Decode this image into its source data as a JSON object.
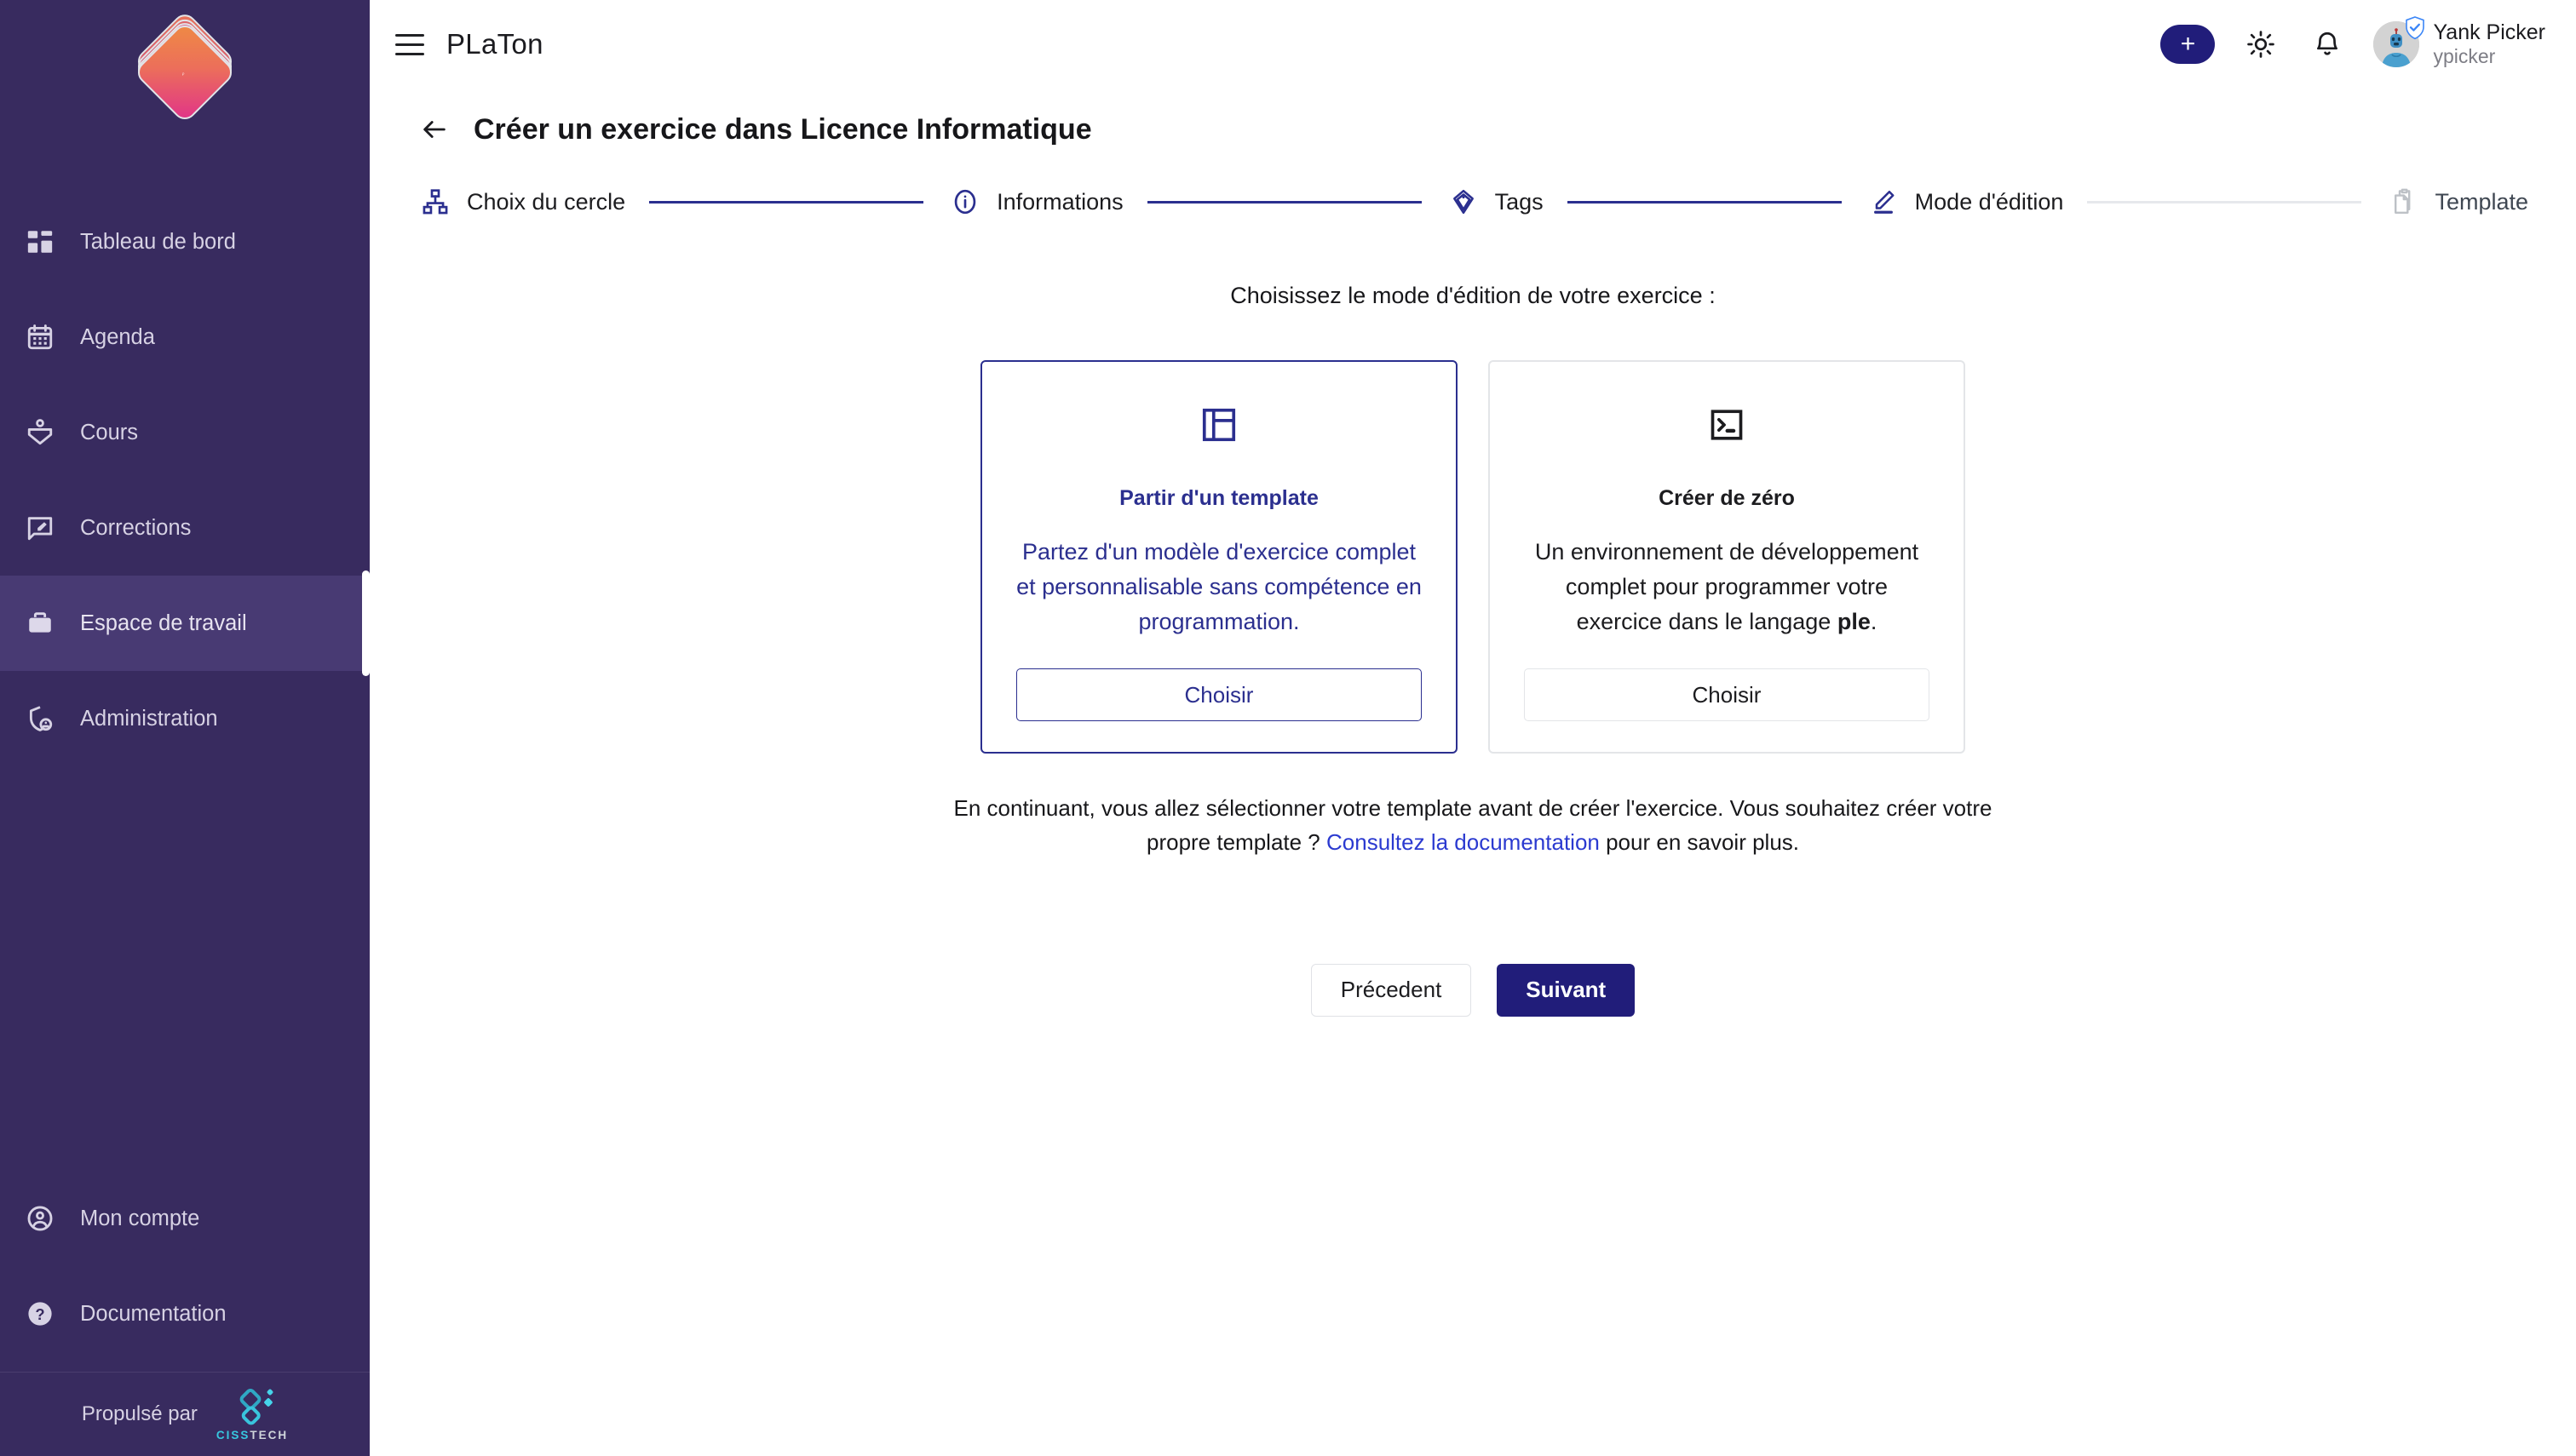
{
  "sidebar": {
    "logo_name": "platon-logo",
    "items": [
      {
        "label": "Tableau de bord",
        "icon": "dashboard-icon",
        "active": false
      },
      {
        "label": "Agenda",
        "icon": "calendar-icon",
        "active": false
      },
      {
        "label": "Cours",
        "icon": "course-icon",
        "active": false
      },
      {
        "label": "Corrections",
        "icon": "review-icon",
        "active": false
      },
      {
        "label": "Espace de travail",
        "icon": "briefcase-icon",
        "active": true
      },
      {
        "label": "Administration",
        "icon": "shield-user-icon",
        "active": false
      }
    ],
    "bottom_items": [
      {
        "label": "Mon compte",
        "icon": "account-circle-icon"
      },
      {
        "label": "Documentation",
        "icon": "help-circle-icon"
      }
    ],
    "powered_by": "Propulsé par",
    "powered_brand_1": "CISS",
    "powered_brand_2": "TECH"
  },
  "header": {
    "menu_icon": "hamburger-icon",
    "brand": "PLaTon",
    "add_label": "+",
    "theme_icon": "sun-icon",
    "notifications_icon": "bell-icon",
    "user_name": "Yank Picker",
    "user_handle": "ypicker"
  },
  "page": {
    "back_icon": "arrow-left-icon",
    "title": "Créer un exercice dans Licence Informatique"
  },
  "stepper": {
    "steps": [
      {
        "label": "Choix du cercle",
        "icon": "sitemap-icon",
        "state": "done"
      },
      {
        "label": "Informations",
        "icon": "info-circle-icon",
        "state": "done"
      },
      {
        "label": "Tags",
        "icon": "tag-icon",
        "state": "done"
      },
      {
        "label": "Mode d'édition",
        "icon": "pencil-icon",
        "state": "current"
      },
      {
        "label": "Template",
        "icon": "document-copy-icon",
        "state": "todo"
      }
    ]
  },
  "main": {
    "instruction": "Choisissez le mode d'édition de votre exercice :",
    "cards": [
      {
        "icon": "layout-template-icon",
        "title": "Partir d'un template",
        "description": "Partez d'un modèle d'exercice complet et personnalisable sans compétence en programmation.",
        "button": "Choisir",
        "selected": true
      },
      {
        "icon": "terminal-icon",
        "title": "Créer de zéro",
        "description_before": "Un environnement de développement complet pour programmer votre exercice dans le langage ",
        "description_bold": "ple",
        "description_after": ".",
        "button": "Choisir",
        "selected": false
      }
    ],
    "note_before": "En continuant, vous allez sélectionner votre template avant de créer l'exercice. Vous souhaitez créer votre propre template ? ",
    "note_link": "Consultez la documentation",
    "note_after": " pour en savoir plus."
  },
  "actions": {
    "previous": "Précedent",
    "next": "Suivant"
  },
  "colors": {
    "sidebar_bg": "#382b5f",
    "sidebar_active": "#483a73",
    "accent_navy": "#211d7a",
    "step_blue": "#2b2f8f",
    "link_blue": "#2b3ad0",
    "inactive_gray": "#e6e8ec"
  }
}
